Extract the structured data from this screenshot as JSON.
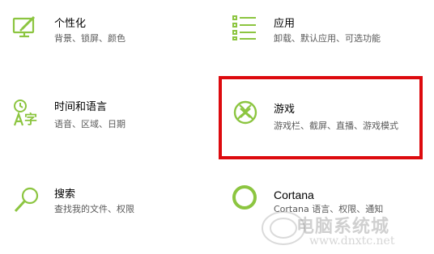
{
  "accent_color": "#8cc540",
  "highlight_color": "#dd0a0e",
  "tiles": [
    {
      "id": "personalization",
      "icon": "personalization-icon",
      "title": "个性化",
      "desc": "背景、锁屏、颜色"
    },
    {
      "id": "apps",
      "icon": "apps-icon",
      "title": "应用",
      "desc": "卸载、默认应用、可选功能"
    },
    {
      "id": "time",
      "icon": "time-language-icon",
      "title": "时间和语言",
      "desc": "语音、区域、日期"
    },
    {
      "id": "gaming",
      "icon": "xbox-icon",
      "title": "游戏",
      "desc": "游戏栏、截屏、直播、游戏模式"
    },
    {
      "id": "search",
      "icon": "search-icon",
      "title": "搜索",
      "desc": "查找我的文件、权限"
    },
    {
      "id": "cortana",
      "icon": "cortana-icon",
      "title": "Cortana",
      "desc": "Cortana 语言、权限、通知"
    }
  ],
  "watermark": {
    "text": "电脑系统城",
    "url": "www.dnxtc.net"
  }
}
